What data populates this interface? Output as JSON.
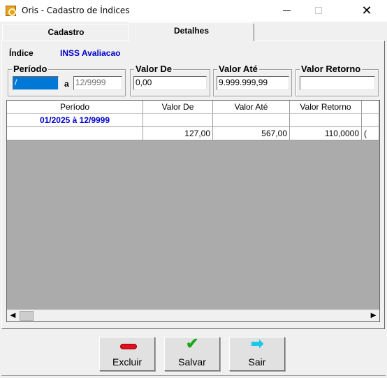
{
  "window": {
    "title": "Oris - Cadastro de Índices",
    "minimize_glyph": "—",
    "close_glyph": "✕"
  },
  "tabs": [
    {
      "label": "Cadastro",
      "active": false
    },
    {
      "label": "Detalhes",
      "active": true
    }
  ],
  "indice": {
    "label": "Índice",
    "value": "INSS Avaliacao"
  },
  "filters": {
    "periodo": {
      "legend": "Período",
      "from_value": "/",
      "separator": "a",
      "to_value": "12/9999"
    },
    "valor_de": {
      "legend": "Valor De",
      "value": "0,00"
    },
    "valor_ate": {
      "legend": "Valor Até",
      "value": "9.999.999,99"
    },
    "valor_retorno": {
      "legend": "Valor Retorno",
      "value": ""
    }
  },
  "grid": {
    "columns": [
      "Período",
      "Valor De",
      "Valor Até",
      "Valor Retorno"
    ],
    "rows": [
      {
        "periodo": "01/2025  à  12/9999",
        "valor_de": "",
        "valor_ate": "",
        "valor_retorno": "",
        "extra": ""
      },
      {
        "periodo": "",
        "valor_de": "127,00",
        "valor_ate": "567,00",
        "valor_retorno": "110,0000",
        "extra": "("
      }
    ]
  },
  "buttons": {
    "excluir": "Excluir",
    "salvar": "Salvar",
    "sair": "Sair"
  },
  "colors": {
    "accent_blue": "#0000cc",
    "selection": "#0078d7",
    "delete_red": "#e0101e",
    "save_green": "#1aa81a",
    "exit_cyan": "#18c8e8"
  }
}
